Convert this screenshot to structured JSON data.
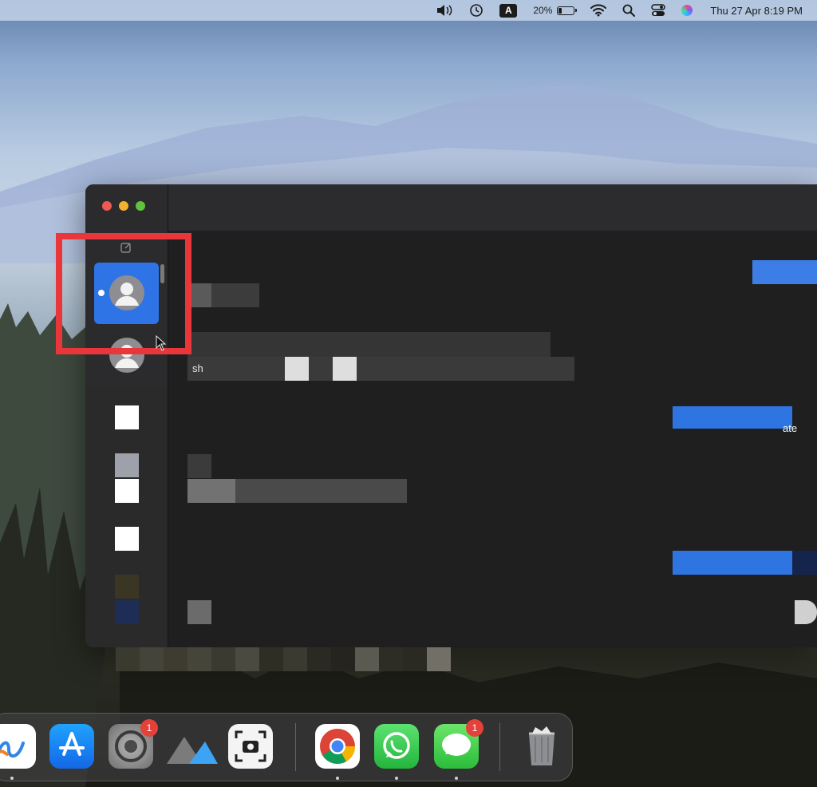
{
  "menubar": {
    "icons": [
      "volume-icon",
      "time-machine-icon",
      "keyboard-input-icon",
      "battery-icon",
      "wifi-icon",
      "spotlight-search-icon",
      "control-center-icon",
      "siri-icon"
    ],
    "input_source_label": "A",
    "battery_percent": "20%",
    "datetime": "Thu 27 Apr  8:19 PM"
  },
  "messages_window": {
    "traffic_lights": [
      "close",
      "minimize",
      "zoom"
    ],
    "compose_icon": "compose-icon",
    "sidebar": {
      "selected_contact_avatar": "person-icon",
      "has_unread_indicator": true
    },
    "conversation": {
      "incoming_preview_fragment_1": "sh",
      "outgoing_fragment_1": "ate"
    }
  },
  "highlight": {
    "color": "#e9363a"
  },
  "dock": {
    "items": [
      {
        "name": "freeform-app",
        "badge": null
      },
      {
        "name": "app-store-app",
        "badge": null
      },
      {
        "name": "system-settings-app",
        "badge": "1"
      },
      {
        "name": "mountain-app",
        "badge": null
      },
      {
        "name": "screenshot-app",
        "badge": null
      },
      {
        "name": "chrome-app",
        "badge": null
      },
      {
        "name": "whatsapp-app",
        "badge": null
      },
      {
        "name": "messages-app",
        "badge": "1"
      },
      {
        "name": "trash",
        "badge": null
      }
    ]
  },
  "colors": {
    "accent_blue": "#2e74e6",
    "close": "#ee5a52",
    "minimize": "#f2b230",
    "zoom": "#5ec43e",
    "badge_red": "#e5413a"
  }
}
